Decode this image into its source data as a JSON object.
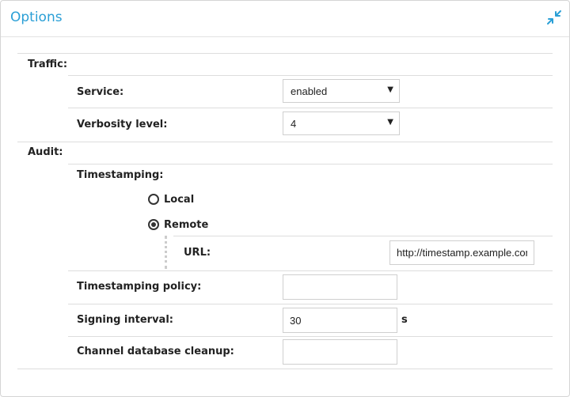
{
  "panel": {
    "title": "Options",
    "collapse_icon": "collapse-arrows-icon"
  },
  "traffic": {
    "label": "Traffic:",
    "service": {
      "label": "Service:",
      "value": "enabled"
    },
    "verbosity": {
      "label": "Verbosity level:",
      "value": "4"
    }
  },
  "audit": {
    "label": "Audit:",
    "timestamping": {
      "label": "Timestamping:",
      "options": [
        {
          "label": "Local",
          "checked": false
        },
        {
          "label": "Remote",
          "checked": true
        }
      ],
      "url": {
        "label": "URL:",
        "value": "http://timestamp.example.com"
      }
    },
    "policy": {
      "label": "Timestamping policy:",
      "value": ""
    },
    "signing_interval": {
      "label": "Signing interval:",
      "value": "30",
      "unit": "s"
    },
    "cleanup": {
      "label": "Channel database cleanup:",
      "value": ""
    }
  },
  "colors": {
    "title": "#2a9fd6",
    "border": "#dddddd"
  }
}
